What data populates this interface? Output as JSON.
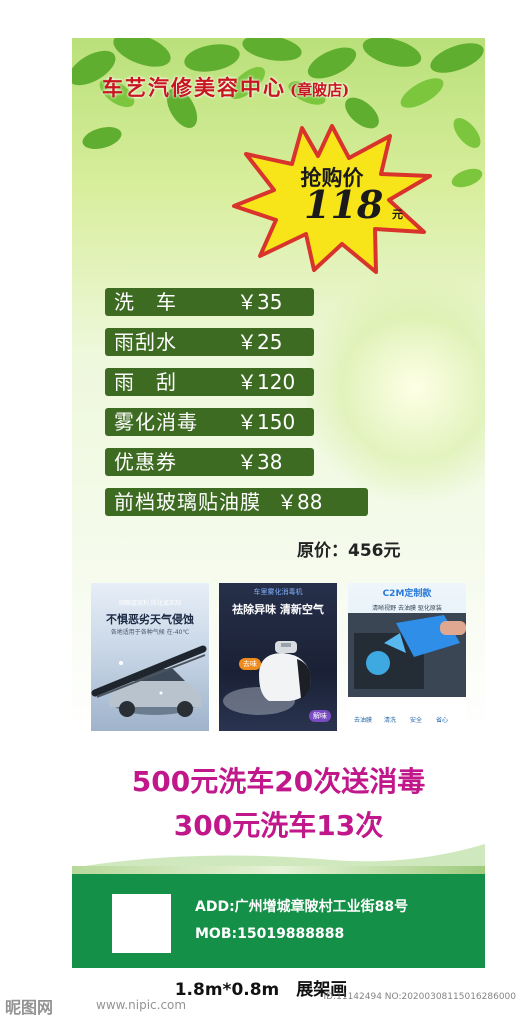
{
  "title": {
    "main": "车艺汽修美容中心",
    "branch": "(章陂店)"
  },
  "burst": {
    "label": "抢购价",
    "price": "118",
    "unit": "元"
  },
  "services": [
    {
      "name": "洗　车",
      "price": "￥35"
    },
    {
      "name": "雨刮水",
      "price": "￥25"
    },
    {
      "name": "雨　刮",
      "price": "￥120"
    },
    {
      "name": "雾化消毒",
      "price": "￥150"
    },
    {
      "name": "优惠券",
      "price": "￥38"
    },
    {
      "name": "前档玻璃贴油膜",
      "price": "￥88"
    }
  ],
  "original_price": "原价：456元",
  "photos": [
    {
      "tag": "刚眼道安利 防化道灰刮",
      "heading": "不惧恶劣天气侵蚀",
      "sub": "各地适用于各种气候 在-40℃"
    },
    {
      "tag": "车里雾化消毒机",
      "heading": "祛除异味 清新空气",
      "chips": [
        "去味",
        "解味"
      ]
    },
    {
      "tag": "C2M定制款",
      "sub": "清晰视野 去油膜 驱化原装",
      "footer_items": [
        "去油膜",
        "清洗",
        "安全",
        "省心"
      ]
    }
  ],
  "promos": [
    "500元洗车20次送消毒",
    "300元洗车13次"
  ],
  "footer": {
    "address": "ADD:广州增城章陂村工业街88号",
    "mobile": "MOB:15019888888"
  },
  "size_note": "1.8m*0.8m　展架画",
  "watermark": {
    "logo": "昵图网",
    "url": "www.nipic.com",
    "id": "ID:11142494 NO:20200308115016286000"
  },
  "colors": {
    "title_red": "#c8161d",
    "tag_green": "#3e6b22",
    "promo_magenta": "#c0178a",
    "footer_green": "#159048",
    "burst_yellow": "#f7e51a",
    "burst_border": "#d9342b"
  }
}
